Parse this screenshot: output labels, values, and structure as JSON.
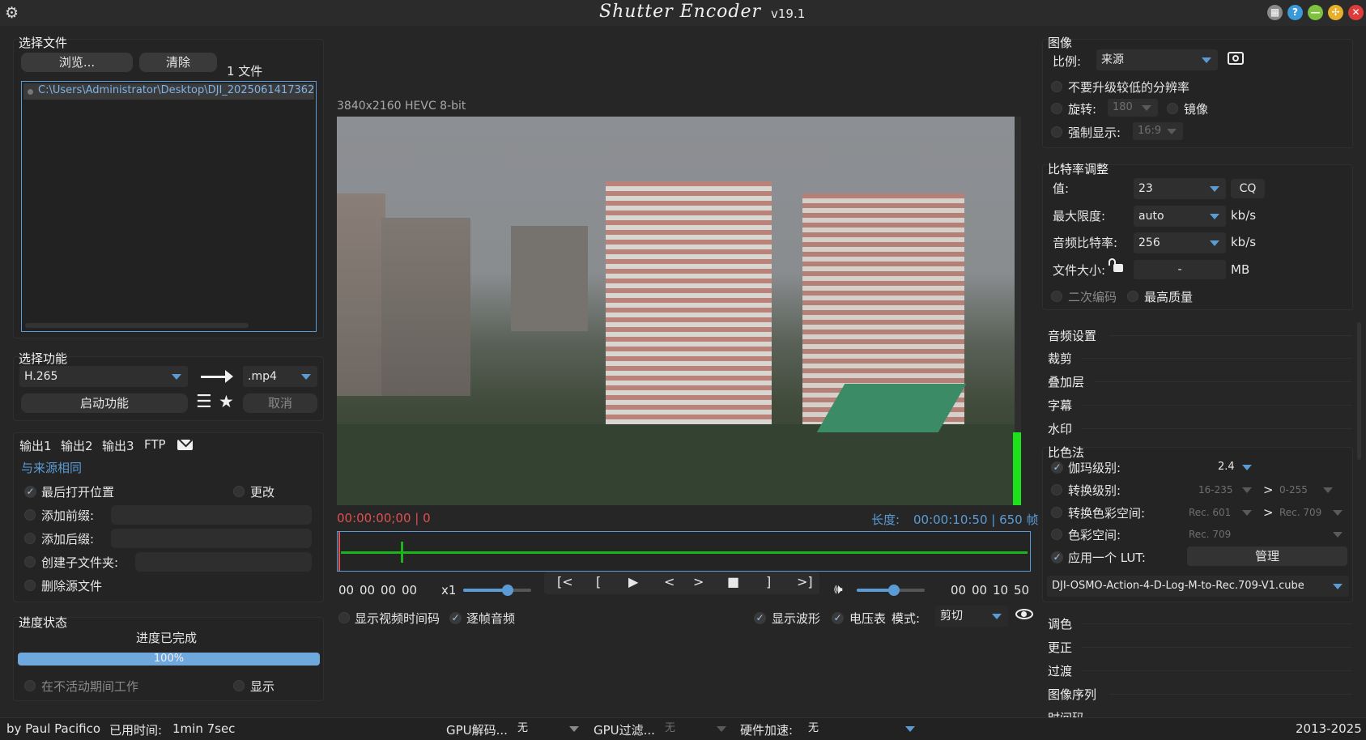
{
  "window": {
    "title": "Shutter Encoder",
    "version": "v19.1"
  },
  "file_panel": {
    "title": "选择文件",
    "browse_label": "浏览...",
    "clear_label": "清除",
    "count_label": "1 文件",
    "files": [
      "C:\\Users\\Administrator\\Desktop\\DJI_2025061417362"
    ]
  },
  "function_panel": {
    "title": "选择功能",
    "codec": "H.265",
    "extension": ".mp4",
    "start_label": "启动功能",
    "cancel_label": "取消"
  },
  "output_panel": {
    "tabs": [
      "输出1",
      "输出2",
      "输出3",
      "FTP"
    ],
    "same_as_source": "与来源相同",
    "last_open_location": "最后打开位置",
    "change_label": "更改",
    "add_prefix": "添加前缀:",
    "add_suffix": "添加后缀:",
    "create_subfolder": "创建子文件夹:",
    "delete_source": "删除源文件"
  },
  "progress_panel": {
    "title": "进度状态",
    "status": "进度已完成",
    "percent_label": "100%",
    "progress": 100,
    "work_idle": "在不活动期间工作",
    "show_label": "显示"
  },
  "player": {
    "video_info": "3840x2160 HEVC 8-bit",
    "current_time": "00:00:00;00 | 0",
    "duration_label": "长度:",
    "duration": "00:00:10:50 | 650 帧",
    "tc_left": [
      "00",
      "00",
      "00",
      "00"
    ],
    "speed": "x1",
    "controls": [
      "[<",
      "[",
      "▶",
      "<",
      ">",
      "■",
      "]",
      ">]"
    ],
    "tc_right": [
      "00",
      "00",
      "10",
      "50"
    ],
    "show_timecode": "显示视频时间码",
    "frame_audio": "逐帧音频",
    "show_waveform": "显示波形",
    "vu_meter": "电压表",
    "mode_label": "模式:",
    "mode_value": "剪切",
    "speed_slider": 0.65,
    "volume_slider": 0.55
  },
  "image_panel": {
    "title": "图像",
    "ratio_label": "比例:",
    "ratio_value": "来源",
    "no_upscale": "不要升级较低的分辨率",
    "rotate_label": "旋转:",
    "rotate_value": "180",
    "mirror_label": "镜像",
    "force_display": "强制显示:",
    "force_value": "16:9"
  },
  "bitrate_panel": {
    "title": "比特率调整",
    "value_label": "值:",
    "value": "23",
    "cq_label": "CQ",
    "max_label": "最大限度:",
    "max_value": "auto",
    "max_unit": "kb/s",
    "audio_label": "音频比特率:",
    "audio_value": "256",
    "audio_unit": "kb/s",
    "size_label": "文件大小:",
    "size_value": "-",
    "size_unit": "MB",
    "two_pass": "二次编码",
    "best_quality": "最高质量"
  },
  "sections_top": [
    "音频设置",
    "裁剪",
    "叠加层",
    "字幕",
    "水印"
  ],
  "colorimetry": {
    "title": "比色法",
    "gamma_label": "伽玛级别:",
    "gamma_value": "2.4",
    "convert_levels": "转换级别:",
    "levels_from": "16-235",
    "levels_to": "0-255",
    "convert_space": "转换色彩空间:",
    "space_from": "Rec. 601",
    "space_to": "Rec. 709",
    "color_space": "色彩空间:",
    "color_space_value": "Rec. 709",
    "apply_lut": "应用一个 LUT:",
    "manage_label": "管理",
    "lut_file": "DJI-OSMO-Action-4-D-Log-M-to-Rec.709-V1.cube",
    "arrow": ">"
  },
  "sections_bottom": [
    "调色",
    "更正",
    "过渡",
    "图像序列",
    "时间码"
  ],
  "status_bar": {
    "author": "by Paul Pacifico",
    "elapsed_label": "已用时间:",
    "elapsed": "1min 7sec",
    "gpu_decode_label": "GPU解码...",
    "gpu_decode_value": "无",
    "gpu_filter_label": "GPU过滤...",
    "gpu_filter_value": "无",
    "hw_label": "硬件加速:",
    "hw_value": "无",
    "years": "2013-2025"
  },
  "colors": {
    "accent": "#5b9bd5",
    "red_time": "#e05050",
    "waveform": "#1db31d",
    "vu": "#1ee11e"
  },
  "icons": [
    "gear-icon",
    "grid-icon",
    "help-icon",
    "minimize-icon",
    "maximize-icon",
    "close-icon",
    "mail-icon",
    "menu-icon",
    "star-icon",
    "camera-icon",
    "lock-icon",
    "volume-icon",
    "eye-icon"
  ]
}
